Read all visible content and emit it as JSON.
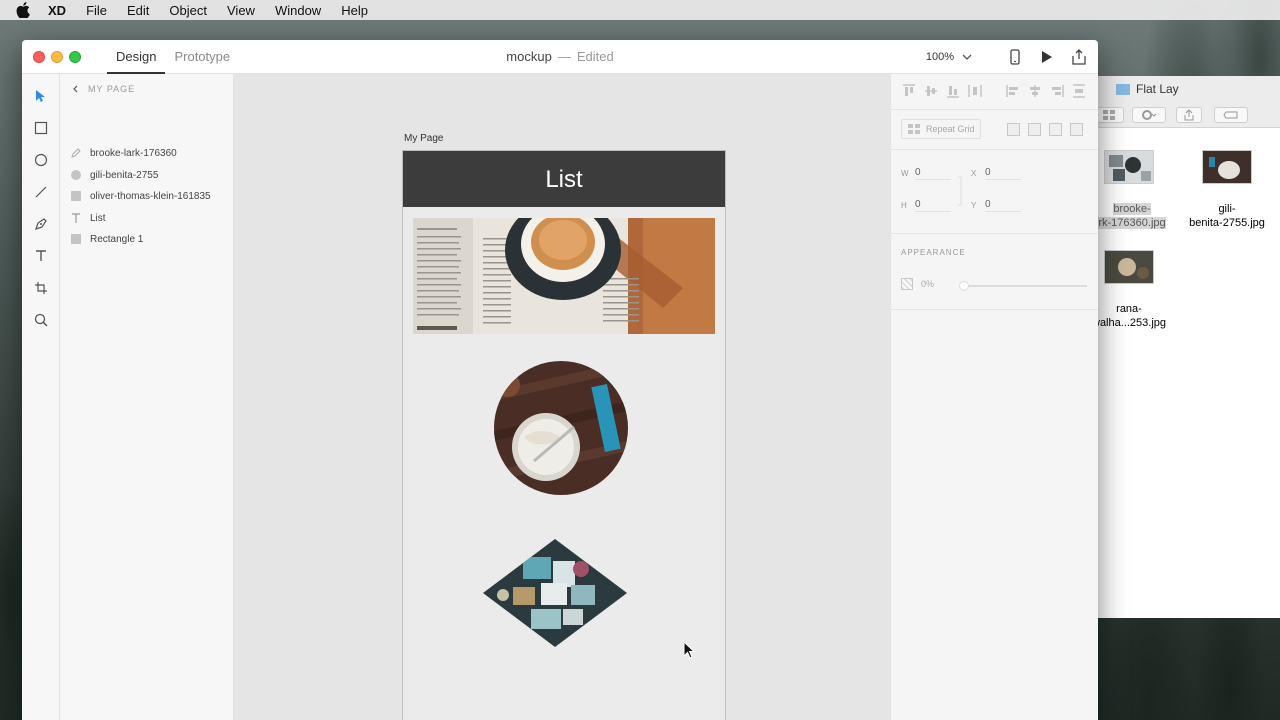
{
  "menubar": {
    "app_name": "XD",
    "items": [
      "File",
      "Edit",
      "Object",
      "View",
      "Window",
      "Help"
    ]
  },
  "window": {
    "tabs": {
      "design": "Design",
      "prototype": "Prototype"
    },
    "doc_name": "mockup",
    "doc_separator": "—",
    "doc_status": "Edited",
    "zoom": "100%"
  },
  "layers": {
    "heading": "MY PAGE",
    "items": [
      {
        "name": "brooke-lark-176360",
        "icon": "pen-icon"
      },
      {
        "name": "gili-benita-2755",
        "icon": "ellipse-icon"
      },
      {
        "name": "oliver-thomas-klein-161835",
        "icon": "rectangle-icon"
      },
      {
        "name": "List",
        "icon": "text-icon"
      },
      {
        "name": "Rectangle 1",
        "icon": "rectangle-icon"
      }
    ]
  },
  "canvas": {
    "artboard_label": "My Page",
    "header_title": "List"
  },
  "inspector": {
    "repeat_grid": "Repeat Grid",
    "w_label": "W",
    "w_value": "0",
    "h_label": "H",
    "h_value": "0",
    "x_label": "X",
    "x_value": "0",
    "y_label": "Y",
    "y_value": "0",
    "appearance_title": "APPEARANCE",
    "opacity_value": "0%",
    "opacity_level": 0
  },
  "finder": {
    "title": "Flat Lay",
    "files": [
      {
        "line1": "brooke-",
        "line2": "rk-176360.jpg",
        "selected": true
      },
      {
        "line1": "gili-",
        "line2": "benita-2755.jpg",
        "selected": false
      },
      {
        "line1": "rana-",
        "line2": "walha...253.jpg",
        "selected": false
      }
    ]
  },
  "colors": {
    "artboard_header": "#3c3c3c",
    "select_tool": "#2d8ceb",
    "canvas_bg": "#e5e5e5"
  }
}
